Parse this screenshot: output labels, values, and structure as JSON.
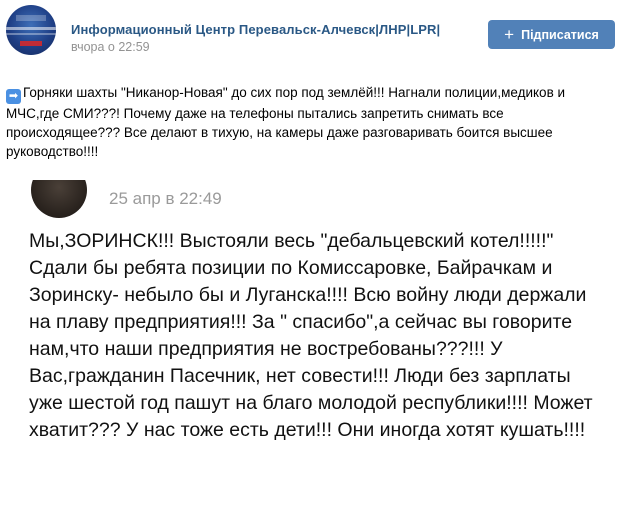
{
  "header": {
    "group_name": "Информационный Центр Перевальск-Алчевск|ЛНР|LPR|",
    "time": "вчора о 22:59",
    "subscribe_label": "Підписатися",
    "subscribe_icon": "plus-icon",
    "device_icon": "apple-icon"
  },
  "post": {
    "arrow_icon": "right-arrow-emoji-icon",
    "text": "Горняки шахты \"Никанор-Новая\" до сих пор под землёй!!! Нагнали полиции,медиков и МЧС,где СМИ???! Почему даже на телефоны пытались запретить снимать все происходящее??? Все делают в тихую, на камеры даже разговаривать боится высшее руководство!!!!"
  },
  "screenshot": {
    "time": "25 апр в 22:49",
    "text": "Мы,ЗОРИНСК!!! Выстояли весь \"дебальцевский котел!!!!!\" Сдали бы ребята позиции по Комиссаровке, Байрачкам и Зоринску- небыло бы и Луганска!!!! Всю войну люди держали на плаву предприятия!!! За \" спасибо\",а сейчас вы говорите нам,что наши предприятия не востребованы???!!! У Вас,гражданин Пасечник, нет совести!!! Люди без зарплаты уже шестой год пашут на благо молодой республики!!!! Может хватит??? У нас тоже есть дети!!! Они иногда хотят кушать!!!!"
  },
  "colors": {
    "link": "#2a5885",
    "button": "#5181b8",
    "meta": "#939393"
  }
}
